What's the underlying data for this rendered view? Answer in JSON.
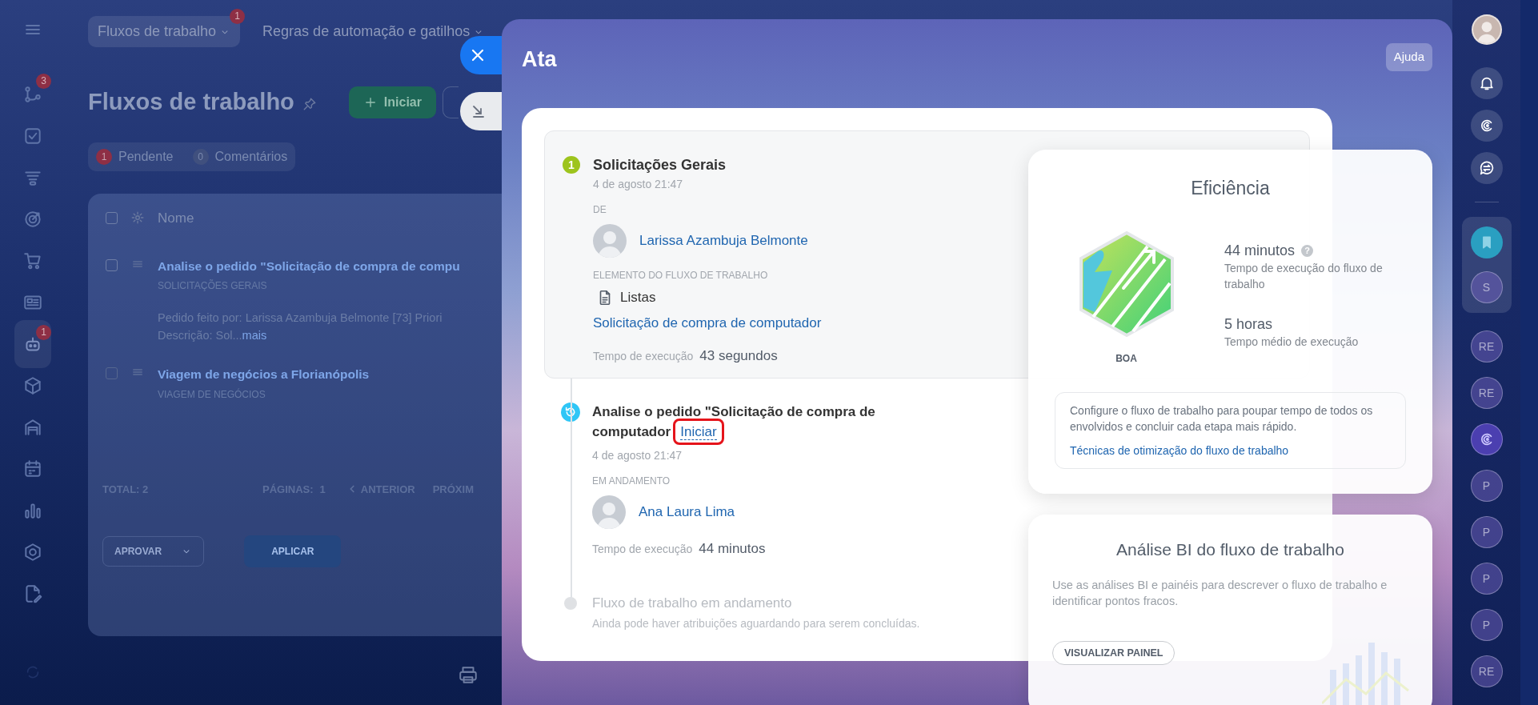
{
  "left_sidebar": {
    "items": [
      {
        "badge": "3",
        "selected": false
      },
      {
        "selected": false
      },
      {
        "selected": false
      },
      {
        "selected": false
      },
      {
        "selected": false
      },
      {
        "selected": false
      },
      {
        "badge": "1",
        "selected": true
      },
      {
        "selected": false
      },
      {
        "selected": false
      },
      {
        "selected": false
      },
      {
        "selected": false
      },
      {
        "selected": false
      },
      {
        "selected": false
      }
    ]
  },
  "page": {
    "tabs": [
      {
        "label": "Fluxos de trabalho",
        "badge": "1",
        "selected": true
      },
      {
        "label": "Regras de automação e gatilhos",
        "selected": false
      }
    ],
    "title": "Fluxos de trabalho",
    "start_button": "Iniciar",
    "filters": [
      {
        "count": "1",
        "label": "Pendente",
        "highlighted": true
      },
      {
        "count": "0",
        "label": "Comentários",
        "highlighted": false
      }
    ],
    "list": {
      "column": "Nome",
      "select_all_checked": false,
      "rows": [
        {
          "checked": false,
          "title": "Analise o pedido \"Solicitação de compra de compu",
          "category": "SOLICITAÇÕES GERAIS",
          "details": "Pedido feito por: Larissa Azambuja Belmonte [73] Priori",
          "description": "Descrição: Sol...",
          "more": "mais"
        },
        {
          "checked": false,
          "title": "Viagem de negócios a Florianópolis",
          "category": "VIAGEM DE NEGÓCIOS"
        }
      ],
      "total": "TOTAL: 2",
      "pages_label": "PÁGINAS:",
      "pages": "1",
      "prev": "ANTERIOR",
      "next": "PRÓXIM",
      "action_select": "APROVAR",
      "apply_button": "APLICAR"
    }
  },
  "panel": {
    "title": "Ata",
    "help_button": "Ajuda",
    "steps": [
      {
        "kind": "done",
        "number": "1",
        "title": "Solicitações Gerais",
        "date": "4 de agosto 21:47",
        "from_label": "DE",
        "person": "Larissa Azambuja Belmonte",
        "element_label": "ELEMENTO DO FLUXO DE TRABALHO",
        "element_type": "Listas",
        "element_link": "Solicitação de compra de computador",
        "time_label": "Tempo de execução",
        "time_value": "43 segundos"
      },
      {
        "kind": "active",
        "title": "Analise o pedido \"Solicitação de compra de computador",
        "action": "Iniciar",
        "highlighted": true,
        "date": "4 de agosto 21:47",
        "status_label": "EM ANDAMENTO",
        "person": "Ana Laura Lima",
        "time_label": "Tempo de execução",
        "time_value": "44 minutos"
      },
      {
        "kind": "pending",
        "title": "Fluxo de trabalho em andamento",
        "note": "Ainda pode haver atribuições aguardando para serem concluídas."
      }
    ],
    "efficiency": {
      "title": "Eficiência",
      "rating": "BOA",
      "stats": [
        {
          "value": "44 minutos",
          "help": "?",
          "label": "Tempo de execução do fluxo de trabalho"
        },
        {
          "value": "5 horas",
          "label": "Tempo médio de execução"
        }
      ],
      "tip": "Configure o fluxo de trabalho para poupar tempo de todos os envolvidos e concluir cada etapa mais rápido.",
      "tip_link": "Técnicas de otimização do fluxo de trabalho"
    },
    "bi": {
      "title": "Análise BI do fluxo de trabalho",
      "text": "Use as análises BI e painéis para descrever o fluxo de trabalho e identificar pontos fracos.",
      "button": "VISUALIZAR PAINEL"
    }
  },
  "right_rail": {
    "pinned": [
      {
        "kind": "bookmark"
      },
      {
        "kind": "initials",
        "text": "S"
      }
    ],
    "chats": [
      {
        "kind": "initials",
        "text": "RE"
      },
      {
        "kind": "initials",
        "text": "RE"
      },
      {
        "kind": "copilot"
      },
      {
        "kind": "initials",
        "text": "P"
      },
      {
        "kind": "initials",
        "text": "P"
      },
      {
        "kind": "initials",
        "text": "P"
      },
      {
        "kind": "initials",
        "text": "P"
      },
      {
        "kind": "initials",
        "text": "RE"
      }
    ]
  }
}
